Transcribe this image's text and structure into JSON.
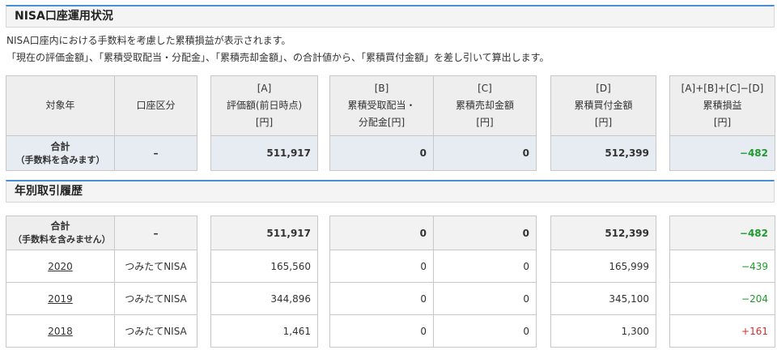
{
  "section1": {
    "title": "NISA口座運用状況",
    "desc_line1": "NISA口座内における手数料を考慮した累積損益が表示されます。",
    "desc_line2": "「現在の評価金額」、「累積受取配当・分配金」、「累積売却金額」、の合計値から、「累積買付金額」を差し引いて算出します。"
  },
  "headers": {
    "year": "対象年",
    "account_type": "口座区分",
    "a_tag": "[A]",
    "a_label": "評価額(前日時点)",
    "b_tag": "[B]",
    "b_label1": "累積受取配当・",
    "b_label2": "分配金[円]",
    "c_tag": "[C]",
    "c_label": "累積売却金額",
    "d_tag": "[D]",
    "d_label": "累積買付金額",
    "pl_tag": "[A]+[B]+[C]−[D]",
    "pl_label": "累積損益",
    "unit": "[円]"
  },
  "summary": {
    "label": "合計",
    "sub": "（手数料を含みます）",
    "account": "–",
    "a": "511,917",
    "b": "0",
    "c": "0",
    "d": "512,399",
    "pl": "−482"
  },
  "section2": {
    "title": "年別取引履歴"
  },
  "history_total": {
    "label": "合計",
    "sub": "（手数料を含みません）",
    "account": "–",
    "a": "511,917",
    "b": "0",
    "c": "0",
    "d": "512,399",
    "pl": "−482"
  },
  "history_rows": [
    {
      "year": "2020",
      "account": "つみたてNISA",
      "a": "165,560",
      "b": "0",
      "c": "0",
      "d": "165,999",
      "pl": "−439",
      "sign": "neg"
    },
    {
      "year": "2019",
      "account": "つみたてNISA",
      "a": "344,896",
      "b": "0",
      "c": "0",
      "d": "345,100",
      "pl": "−204",
      "sign": "neg"
    },
    {
      "year": "2018",
      "account": "つみたてNISA",
      "a": "1,461",
      "b": "0",
      "c": "0",
      "d": "1,300",
      "pl": "+161",
      "sign": "pos"
    }
  ],
  "colors": {
    "accent": "#4a8fd6",
    "gain": "#d32f2f",
    "loss": "#1f9a2f"
  }
}
